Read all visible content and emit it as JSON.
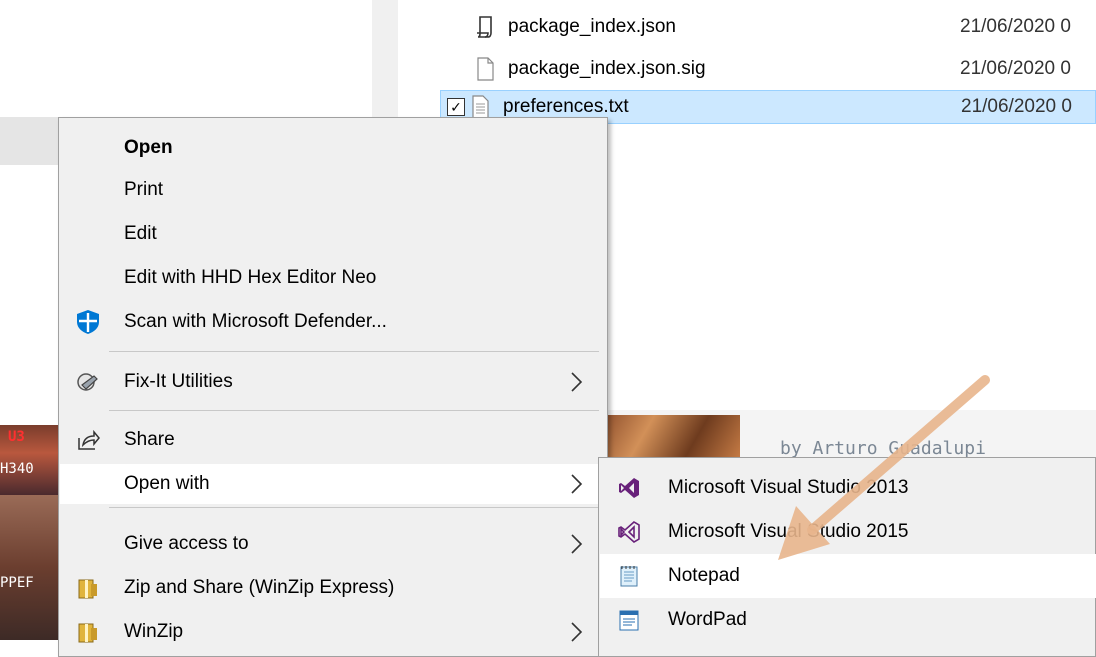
{
  "files": [
    {
      "name": "package_index.json",
      "date": "21/06/2020 0",
      "icon": "script-file-icon",
      "selected": false
    },
    {
      "name": "package_index.json.sig",
      "date": "21/06/2020 0",
      "icon": "blank-file-icon",
      "selected": false
    },
    {
      "name": "preferences.txt",
      "date": "21/06/2020 0",
      "icon": "text-file-icon",
      "selected": true
    }
  ],
  "background": {
    "credit": "by Arturo Guadalupi",
    "left_thumb_top": "U3",
    "left_thumb_mid": "H340",
    "left_thumb_low": "PPEF"
  },
  "context_menu": {
    "items": [
      {
        "label": "Open",
        "bold": true
      },
      {
        "label": "Print"
      },
      {
        "label": "Edit"
      },
      {
        "label": "Edit with HHD Hex Editor Neo"
      },
      {
        "label": "Scan with Microsoft Defender...",
        "icon": "defender-shield-icon"
      },
      {
        "label": "Fix-It Utilities",
        "icon": "fixit-wrench-icon",
        "submenu": true
      },
      {
        "label": "Share",
        "icon": "share-icon"
      },
      {
        "label": "Open with",
        "submenu": true,
        "hover": true
      },
      {
        "label": "Give access to",
        "submenu": true
      },
      {
        "label": "Zip and Share (WinZip Express)",
        "icon": "winzip-icon"
      },
      {
        "label": "WinZip",
        "icon": "winzip-icon",
        "submenu": true
      }
    ]
  },
  "open_with_submenu": {
    "items": [
      {
        "label": "Microsoft Visual Studio 2013",
        "icon": "visual-studio-2013-icon"
      },
      {
        "label": "Microsoft Visual Studio 2015",
        "icon": "visual-studio-2015-icon"
      },
      {
        "label": "Notepad",
        "icon": "notepad-icon",
        "hover": true
      },
      {
        "label": "WordPad",
        "icon": "wordpad-icon"
      }
    ]
  },
  "colors": {
    "menu_bg": "#f0f0f0",
    "selection_bg": "#cce8ff",
    "selection_border": "#99d1ff",
    "vs_purple": "#68217a",
    "defender_blue": "#0078d4",
    "annotation_arrow": "#e8b58c"
  }
}
